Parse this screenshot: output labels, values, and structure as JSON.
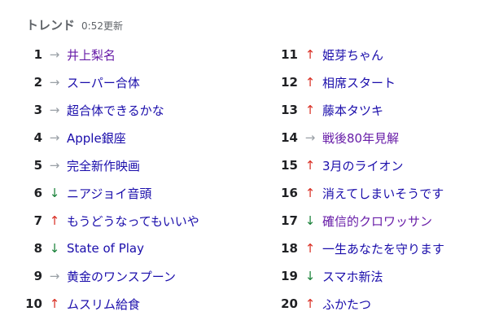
{
  "header": {
    "title": "トレンド",
    "updated": "0:52更新"
  },
  "icons": {
    "up": "↑",
    "down": "↓",
    "flat": "→"
  },
  "colors": {
    "link": "#1a0dab",
    "visited": "#681da8",
    "up": "#d93025",
    "down": "#188038",
    "flat": "#9aa0a6"
  },
  "trends": [
    {
      "rank": "1",
      "trend": "flat",
      "term": "井上梨名",
      "visited": true
    },
    {
      "rank": "2",
      "trend": "flat",
      "term": "スーパー合体",
      "visited": false
    },
    {
      "rank": "3",
      "trend": "flat",
      "term": "超合体できるかな",
      "visited": false
    },
    {
      "rank": "4",
      "trend": "flat",
      "term": "Apple銀座",
      "visited": false
    },
    {
      "rank": "5",
      "trend": "flat",
      "term": "完全新作映画",
      "visited": false
    },
    {
      "rank": "6",
      "trend": "down",
      "term": "ニアジョイ音頭",
      "visited": false
    },
    {
      "rank": "7",
      "trend": "up",
      "term": "もうどうなってもいいや",
      "visited": false
    },
    {
      "rank": "8",
      "trend": "down",
      "term": "State of Play",
      "visited": false
    },
    {
      "rank": "9",
      "trend": "flat",
      "term": "黄金のワンスプーン",
      "visited": false
    },
    {
      "rank": "10",
      "trend": "up",
      "term": "ムスリム給食",
      "visited": false
    },
    {
      "rank": "11",
      "trend": "up",
      "term": "姫芽ちゃん",
      "visited": false
    },
    {
      "rank": "12",
      "trend": "up",
      "term": "相席スタート",
      "visited": false
    },
    {
      "rank": "13",
      "trend": "up",
      "term": "藤本タツキ",
      "visited": false
    },
    {
      "rank": "14",
      "trend": "flat",
      "term": "戦後80年見解",
      "visited": true
    },
    {
      "rank": "15",
      "trend": "up",
      "term": "3月のライオン",
      "visited": false
    },
    {
      "rank": "16",
      "trend": "up",
      "term": "消えてしまいそうです",
      "visited": false
    },
    {
      "rank": "17",
      "trend": "down",
      "term": "確信的クロワッサン",
      "visited": true
    },
    {
      "rank": "18",
      "trend": "up",
      "term": "一生あなたを守ります",
      "visited": false
    },
    {
      "rank": "19",
      "trend": "down",
      "term": "スマホ新法",
      "visited": false
    },
    {
      "rank": "20",
      "trend": "up",
      "term": "ふかたつ",
      "visited": false
    }
  ]
}
